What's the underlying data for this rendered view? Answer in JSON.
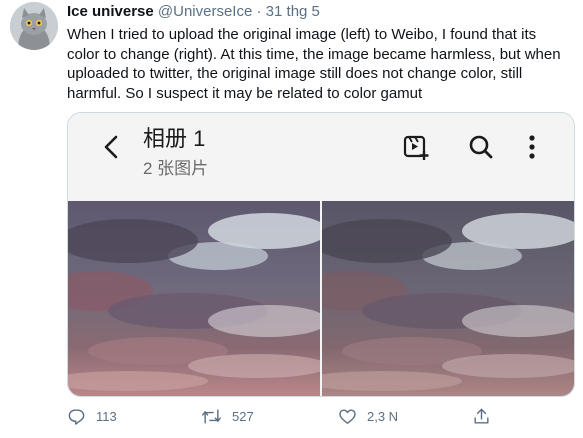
{
  "tweet": {
    "display_name": "Ice universe",
    "handle": "@UniverseIce",
    "separator": "·",
    "time": "31 thg 5",
    "text": "When I tried to upload the original image (left) to Weibo, I found that its color to change (right). At this time, the image became harmless, but when uploaded to twitter, the original image still does not change color, still harmful. So I suspect it may be related to color gamut"
  },
  "media": {
    "album_title": "相册 1",
    "album_count": "2 张图片",
    "icons": [
      "back-chevron-icon",
      "video-add-icon",
      "search-icon",
      "more-vertical-icon"
    ]
  },
  "actions": {
    "replies": "113",
    "retweets": "527",
    "likes": "2,3 N",
    "icons": [
      "reply-icon",
      "retweet-icon",
      "like-icon",
      "share-icon"
    ]
  },
  "colors": {
    "secondary_text": "#5b7083",
    "border": "#cfd9de"
  }
}
